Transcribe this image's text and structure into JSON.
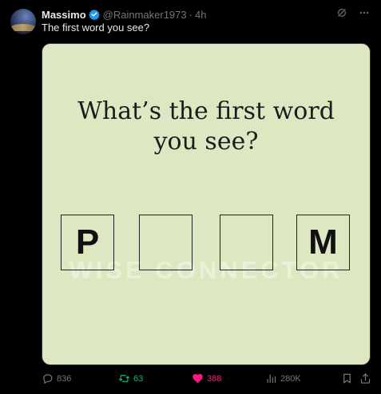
{
  "tweet": {
    "author_name": "Massimo",
    "handle": "@Rainmaker1973",
    "separator": "·",
    "time": "4h",
    "text": "The first word you see?",
    "verified": true
  },
  "media": {
    "title_line1": "What’s the first word",
    "title_line2": "you see?",
    "letter_boxes": [
      "P",
      "",
      "",
      "M"
    ],
    "watermark": "WISE CONNECTOR",
    "background_color": "#dde8c2"
  },
  "actions": {
    "replies": "836",
    "reposts": "63",
    "likes": "388",
    "views": "280K"
  },
  "colors": {
    "background": "#000000",
    "text_primary": "#e7e9ea",
    "text_secondary": "#71767b",
    "verified": "#1d9bf0",
    "repost_active": "#00ba7c",
    "like_active": "#f91880"
  },
  "icons": [
    "verified-badge-icon",
    "grok-icon",
    "more-icon",
    "reply-icon",
    "repost-icon",
    "like-icon",
    "views-icon",
    "bookmark-icon",
    "share-icon"
  ]
}
